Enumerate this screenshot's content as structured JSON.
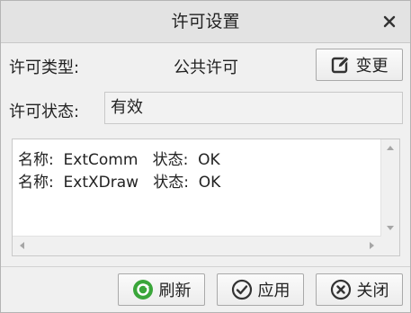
{
  "dialog": {
    "title": "许可设置",
    "close_icon": "close-icon"
  },
  "license_type": {
    "label": "许可类型:",
    "value": "公共许可",
    "change_button": "变更",
    "change_icon": "edit-icon"
  },
  "license_status": {
    "label": "许可状态:",
    "value": "有效"
  },
  "license_list": [
    "名称:  ExtComm   状态:  OK",
    "名称:  ExtXDraw   状态:  OK"
  ],
  "footer": {
    "refresh_button": "刷新",
    "refresh_icon": "refresh-icon",
    "apply_button": "应用",
    "apply_icon": "check-circle-icon",
    "close_button": "关闭",
    "close_icon": "close-circle-icon"
  },
  "colors": {
    "refresh_green": "#3aa63a",
    "dark_icon": "#333333"
  }
}
